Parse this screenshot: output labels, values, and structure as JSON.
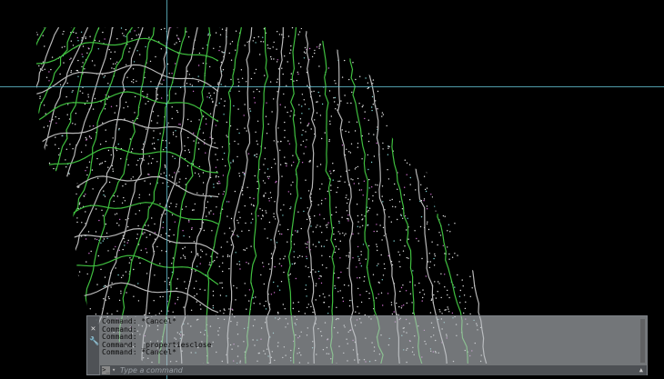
{
  "canvas": {
    "background": "#000000",
    "contour_colors": {
      "index": "#3fbf3f",
      "intermediate": "#b8b8b8",
      "points": "#e8e8e8"
    },
    "crosshair_color": "#5fb7c7"
  },
  "command_line": {
    "history": [
      "Command: *Cancel*",
      "Command:",
      "Command:",
      "Command: _propertiesclose",
      "Command: *Cancel*"
    ],
    "input_placeholder": "Type a command",
    "input_value": "",
    "icons": {
      "close": "close-icon",
      "customize": "wrench-icon",
      "prompt": "command-prompt-icon",
      "recent": "chevron-down-icon",
      "scroll": "triangle-up-icon"
    }
  }
}
